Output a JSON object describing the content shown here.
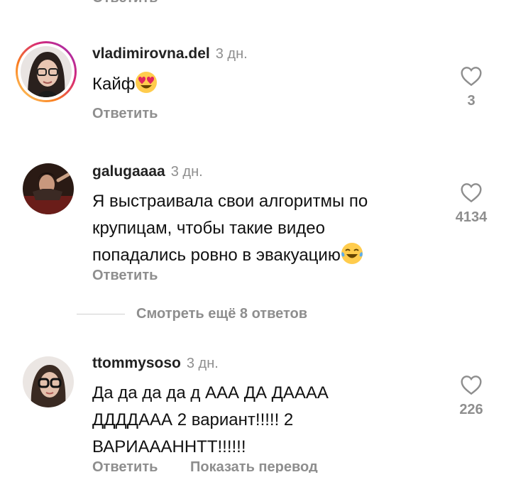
{
  "top_reply": "Ответить",
  "comments": [
    {
      "username": "vladimirovna.del",
      "time": "3 дн.",
      "text": "Кайф",
      "emoji": "heart-eyes",
      "reply": "Ответить",
      "likes": "3"
    },
    {
      "username": "galugaaaa",
      "time": "3 дн.",
      "lines": [
        "Я выстраивала свои алгоритмы по",
        "крупицам, чтобы такие видео",
        "попадались ровно в эвакуацию"
      ],
      "emoji": "tears-of-joy",
      "reply": "Ответить",
      "likes": "4134"
    },
    {
      "username": "ttommysoso",
      "time": "3 дн.",
      "lines": [
        "Да да да да д ААА ДА ДАААА",
        "ДДДДААА 2 вариант!!!!! 2",
        "ВАРИАААННТТ!!!!!!"
      ],
      "reply": "Ответить",
      "translate": "Показать перевод",
      "likes": "226"
    }
  ],
  "view_more": "Смотреть ещё 8 ответов",
  "colors": {
    "muted": "#8e8e8e",
    "text": "#111111"
  }
}
